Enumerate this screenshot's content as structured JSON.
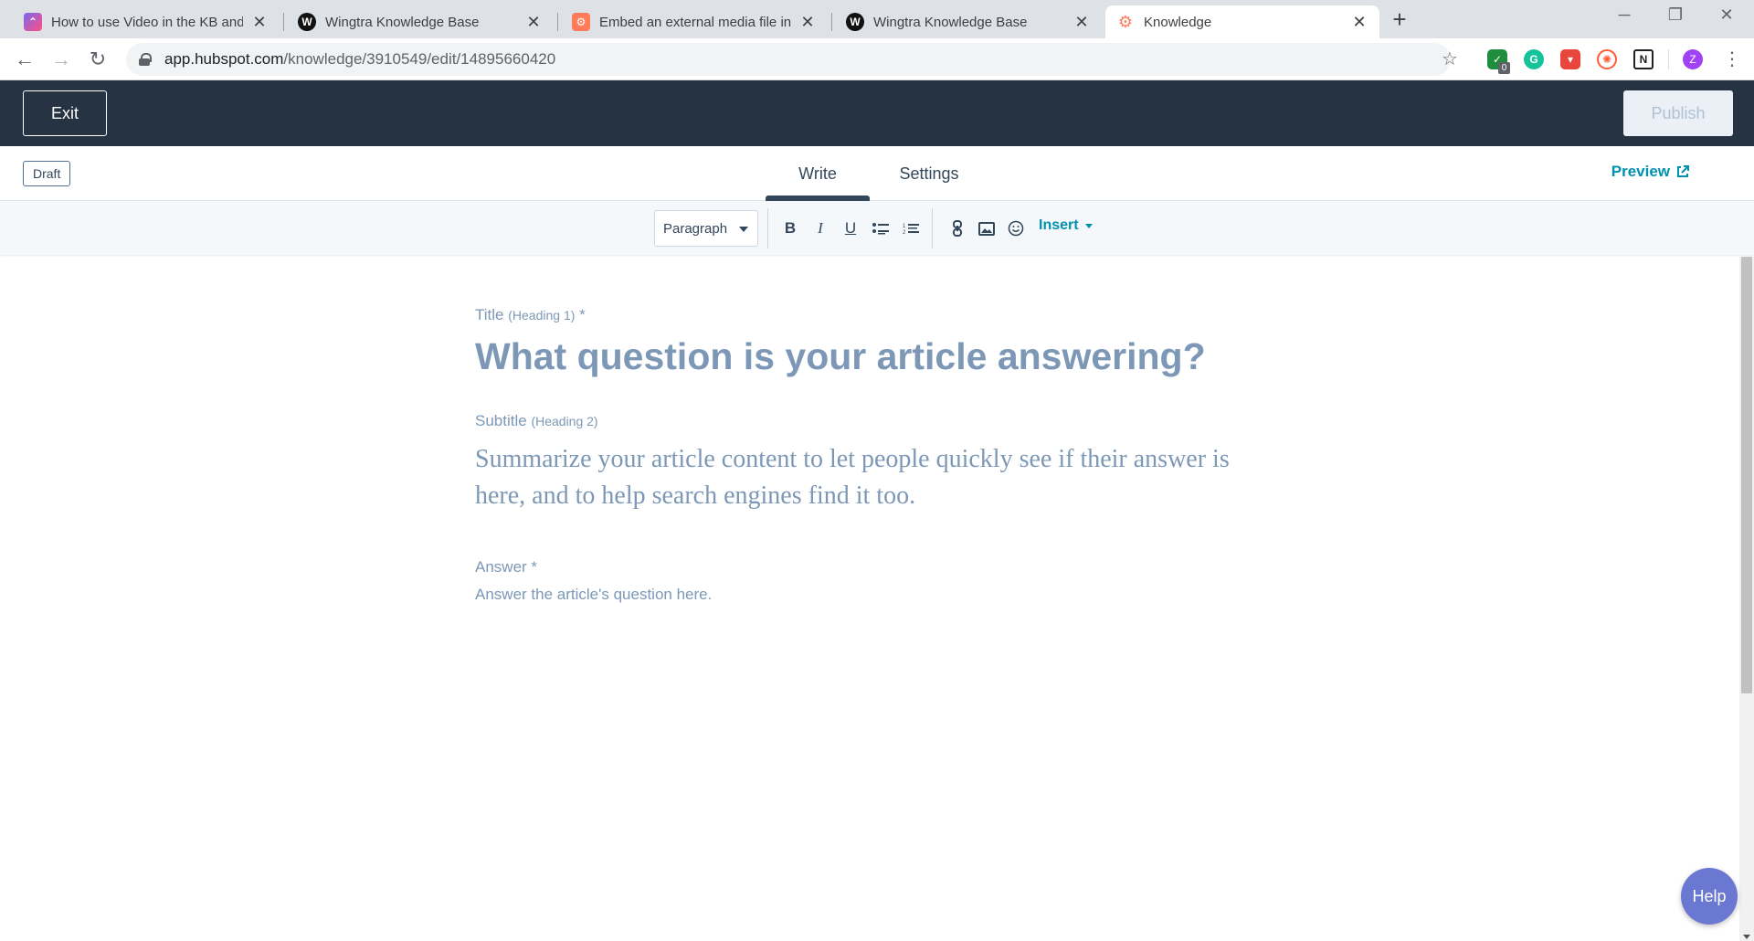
{
  "browser": {
    "tabs": [
      {
        "title": "How to use Video in the KB and I",
        "icon": "clickup-icon",
        "active": false
      },
      {
        "title": "Wingtra Knowledge Base",
        "icon": "wingtra-icon",
        "active": false
      },
      {
        "title": "Embed an external media file in y",
        "icon": "hubspot-icon",
        "active": false
      },
      {
        "title": "Wingtra Knowledge Base",
        "icon": "wingtra-icon",
        "active": false
      },
      {
        "title": "Knowledge",
        "icon": "hubspot-icon",
        "active": true
      }
    ],
    "url_host": "app.hubspot.com",
    "url_path": "/knowledge/3910549/edit/14895660420",
    "extension_badge": "0",
    "profile_initial": "Z"
  },
  "header": {
    "exit_label": "Exit",
    "publish_label": "Publish"
  },
  "subheader": {
    "status": "Draft",
    "tabs": [
      "Write",
      "Settings"
    ],
    "preview_label": "Preview"
  },
  "toolbar": {
    "paragraph_label": "Paragraph",
    "insert_label": "Insert"
  },
  "editor": {
    "title_label": "Title",
    "title_hint": "(Heading 1)",
    "title_required": "*",
    "title_placeholder": "What question is your article answering?",
    "subtitle_label": "Subtitle",
    "subtitle_hint": "(Heading 2)",
    "subtitle_placeholder": "Summarize your article content to let people quickly see if their answer is here, and to help search engines find it too.",
    "answer_label": "Answer",
    "answer_required": "*",
    "answer_placeholder": "Answer the article's question here."
  },
  "help_label": "Help",
  "colors": {
    "header_bg": "#253342",
    "accent": "#0091ae",
    "placeholder": "#7c98b6",
    "help_bg": "#6a78d1"
  }
}
